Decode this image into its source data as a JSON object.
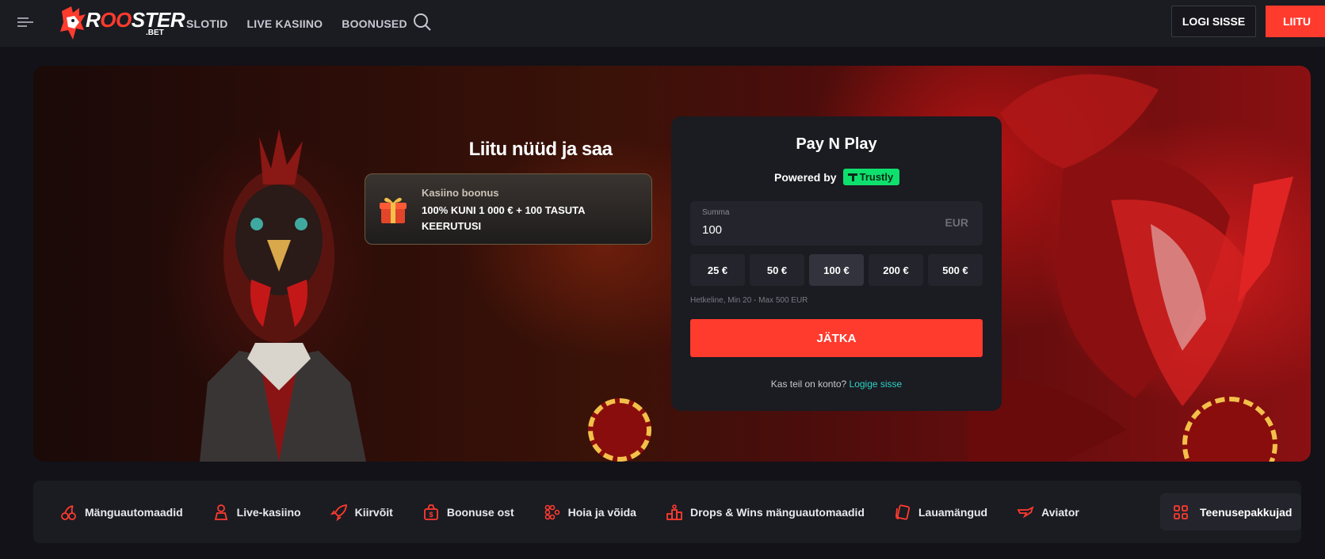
{
  "header": {
    "logo_text": "ROOSTER",
    "logo_sub": ".BET",
    "nav": [
      "SLOTID",
      "LIVE KASIINO",
      "BOONUSED"
    ],
    "login_label": "LOGI SISSE",
    "join_label": "LIITU"
  },
  "hero": {
    "title": "Liitu nüüd ja saa",
    "promo": {
      "label": "Kasiino boonus",
      "text": "100% KUNI 1 000 € + 100 TASUTA KEERUTUSI"
    }
  },
  "pay": {
    "title": "Pay N Play",
    "powered_by": "Powered by",
    "trustly_label": "Trustly",
    "amount_label": "Summa",
    "amount_value": "100",
    "currency": "EUR",
    "amounts": [
      "25 €",
      "50 €",
      "100 €",
      "200 €",
      "500 €"
    ],
    "selected_amount": "100 €",
    "limits": "Hetkeline, Min 20 - Max 500 EUR",
    "continue_label": "JÄTKA",
    "account_question": "Kas teil on konto?",
    "login_link": "Logige sisse"
  },
  "categories": [
    {
      "label": "Mänguautomaadid",
      "icon": "cherries-icon"
    },
    {
      "label": "Live-kasiino",
      "icon": "dealer-icon"
    },
    {
      "label": "Kiirvõit",
      "icon": "rocket-icon"
    },
    {
      "label": "Boonuse ost",
      "icon": "bonus-bag-icon"
    },
    {
      "label": "Hoia ja võida",
      "icon": "dots-icon"
    },
    {
      "label": "Drops & Wins mänguautomaadid",
      "icon": "podium-icon"
    },
    {
      "label": "Lauamängud",
      "icon": "cards-icon"
    },
    {
      "label": "Aviator",
      "icon": "plane-icon"
    }
  ],
  "providers_label": "Teenusepakkujad",
  "colors": {
    "accent": "#ff3b2e",
    "trustly": "#0ee06e",
    "link": "#2fd3c4",
    "background": "#121218",
    "panel": "#1b1b22"
  }
}
